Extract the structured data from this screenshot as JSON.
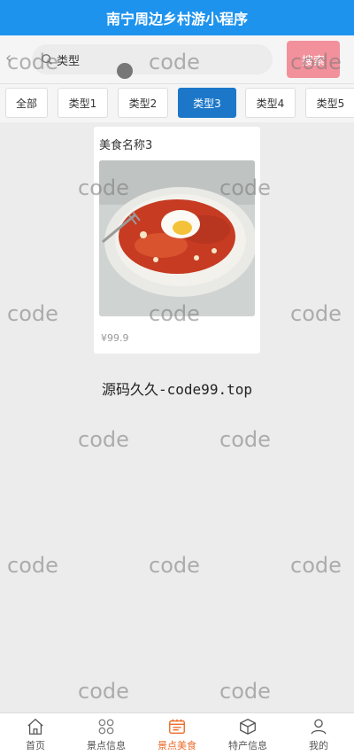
{
  "app": {
    "title": "南宁周边乡村游小程序"
  },
  "search": {
    "value": "类型",
    "button_label": "搜索"
  },
  "categories": [
    {
      "label": "全部",
      "active": false
    },
    {
      "label": "类型1",
      "active": false
    },
    {
      "label": "类型2",
      "active": false
    },
    {
      "label": "类型3",
      "active": true
    },
    {
      "label": "类型4",
      "active": false
    },
    {
      "label": "类型5",
      "active": false
    }
  ],
  "items": [
    {
      "name": "美食名称3",
      "price": "¥99.9"
    }
  ],
  "footer_note": "源码久久-code99.top",
  "watermark": "code",
  "tabbar": [
    {
      "label": "首页",
      "icon": "home-icon",
      "active": false
    },
    {
      "label": "景点信息",
      "icon": "grid-icon",
      "active": false
    },
    {
      "label": "景点美食",
      "icon": "food-icon",
      "active": true
    },
    {
      "label": "特产信息",
      "icon": "box-icon",
      "active": false
    },
    {
      "label": "我的",
      "icon": "user-icon",
      "active": false
    }
  ],
  "colors": {
    "header": "#1e93ee",
    "active_tab": "#1c77c9",
    "search_button": "#f2909b",
    "tabbar_active": "#ea6b2a"
  }
}
